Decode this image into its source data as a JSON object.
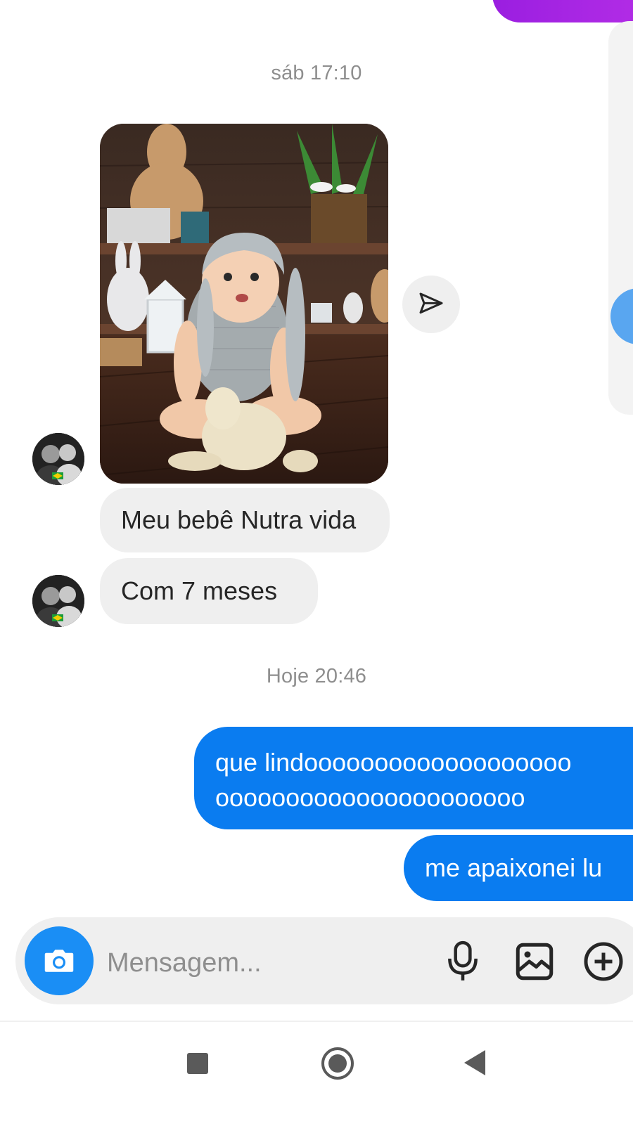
{
  "thread": {
    "timestamp_1": "sáb 17:10",
    "incoming_1": "Meu bebê Nutra vida",
    "incoming_2": "Com 7 meses",
    "timestamp_2": "Hoje 20:46",
    "outgoing_1_line1": "que lindooooooooooooooooooo",
    "outgoing_1_line2": "oooooooooooooooooooooo",
    "outgoing_2": "me apaixonei lu"
  },
  "composer": {
    "placeholder": "Mensagem...",
    "icons": [
      "camera-icon",
      "microphone-icon",
      "image-icon",
      "plus-circle-icon"
    ]
  },
  "navbar": {
    "icons": [
      "recent-apps-icon",
      "home-icon",
      "back-icon"
    ]
  },
  "colors": {
    "outgoing_bubble": "#0a7cf0",
    "incoming_bubble": "#efefef",
    "camera_button": "#1a8ef5",
    "top_bubble": "#9a1ee0"
  }
}
